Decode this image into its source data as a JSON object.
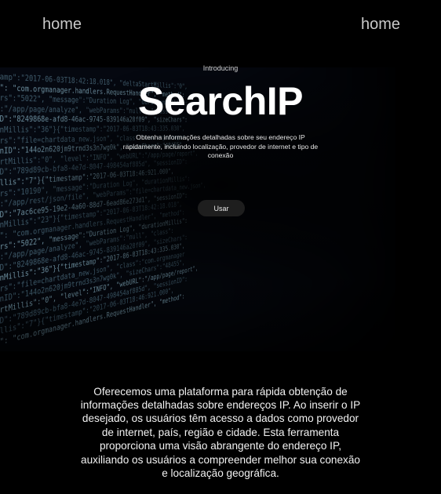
{
  "nav": {
    "left_label": "home",
    "right_label": "home"
  },
  "hero": {
    "eyebrow": "Introducing",
    "title": "SearchIP",
    "subtitle": "Obtenha informações detalhadas sobre seu endereço IP rapidamente, incluindo localização, provedor de internet e tipo de conexão",
    "cta_label": "Usar",
    "code_lines": [
      "tamp\":\"2017-06-03T18:42:18.018\", \"deltaStartMillis\":\"0\",",
      "s\": \"com.orgmanager.handlers.RequestHandler\", \"method\":",
      "ars\":\"5022\", \"message\":\"Duration Log\", \"durationMillis\":",
      "\":\"/app/page/analyze\", \"webParams\":\"null\", \"class\":",
      "ID\":\"8249868e-afd8-46ac-9745-839146a20f09\", \"sizeChars\":",
      "onMillis\":\"36\"}{\"timestamp\":\"2017-06-03T18:43:335.030\",",
      "ars\":\"file=chartdata_new.json\", \"class\":\"com.orgmanager",
      "onID\":\"144o2n620jm9trnd3s3n7wg0k\", \"sizeChars\":\"48455\",",
      "artMillis\":\"0\", \"level\":\"INFO\", \"webURL\":\"/app/page/report\",",
      "ID\":\"789d89cb-bfa8-4e7d-8047-498454af885d\", \"sessionID\":",
      "illis\":\"7\"}{\"timestamp\":\"2017-06-03T18:46:921.000\",",
      "ars\":\"10190\", \"message\":\"Duration Log\", \"durationMillis\":",
      "\":\"/app/rest/json/file\", \"webParams\":\"file=chartdata_new.json\",",
      "ID\":\"7ac6ce95-19e2-4a60-88d7-6ead86e273d1\", \"sessionID\":",
      "onMillis\":\"23\"}{\"timestamp\":\"2017-06-03T18:42:18.018\",",
      "s\": \"com.orgmanager.handlers.RequestHandler\", \"method\":",
      "ars\":\"5022\", \"message\":\"Duration Log\", \"durationMillis\":",
      "\":\"/app/page/analyze\", \"webParams\":\"null\", \"class\":",
      "ID\":\"8249868e-afd8-46ac-9745-839146a20f09\", \"sizeChars\":",
      "onMillis\":\"36\"}{\"timestamp\":\"2017-06-03T18:43:335.030\",",
      "ars\":\"file=chartdata_new.json\", \"class\":\"com.orgmanager",
      "onID\":\"144o2n620jm9trnd3s3n7wg0k\", \"sizeChars\":\"48455\",",
      "artMillis\":\"0\", \"level\":\"INFO\", \"webURL\":\"/app/page/report\",",
      "ID\":\"789d89cb-bfa8-4e7d-8047-498454af885d\", \"sessionID\":",
      "illis\":\"7\"}{\"timestamp\":\"2017-06-03T18:46:921.000\",",
      "s\": \"com.orgmanager.handlers.RequestHandler\", \"method\":"
    ]
  },
  "about": {
    "text": "Oferecemos uma plataforma para rápida obtenção de informações detalhadas sobre endereços IP. Ao inserir o IP desejado, os usuários têm acesso a dados como provedor de internet, país, região e cidade. Esta ferramenta proporciona uma visão abrangente do endereço IP, auxiliando os usuários a compreender melhor sua conexão e localização geográfica."
  },
  "colors": {
    "background": "#000000",
    "code_text": "#3e5a6a",
    "button_bg": "#1e1e1e"
  }
}
